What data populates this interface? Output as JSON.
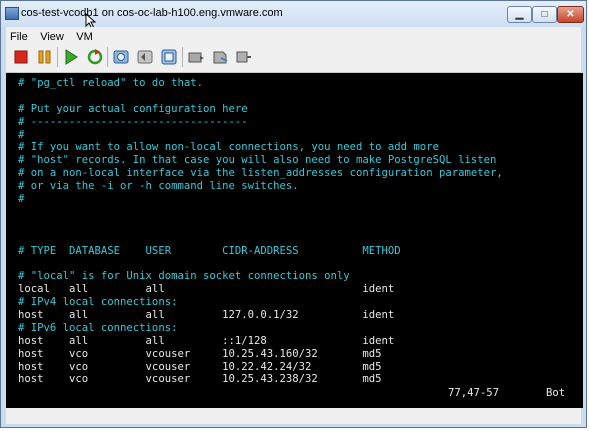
{
  "window": {
    "title": "cos-test-vcodb1 on cos-oc-lab-h100.eng.vmware.com"
  },
  "menu": [
    "File",
    "View",
    "VM"
  ],
  "toolbar": {
    "buttons": [
      "power-off",
      "suspend",
      "power-on",
      "reset",
      "snapshot",
      "revert-snapshot",
      "manage-snapshots",
      "connect-cd",
      "connect-floppy",
      "connect-network"
    ]
  },
  "console": {
    "lines": [
      {
        "cls": "cmt",
        "text": "# \"pg_ctl reload\" to do that."
      },
      {
        "cls": "cmt",
        "text": ""
      },
      {
        "cls": "cmt",
        "text": "# Put your actual configuration here"
      },
      {
        "cls": "cmt",
        "text": "# ----------------------------------"
      },
      {
        "cls": "cmt",
        "text": "#"
      },
      {
        "cls": "cmt",
        "text": "# If you want to allow non-local connections, you need to add more"
      },
      {
        "cls": "cmt",
        "text": "# \"host\" records. In that case you will also need to make PostgreSQL listen"
      },
      {
        "cls": "cmt",
        "text": "# on a non-local interface via the listen_addresses configuration parameter,"
      },
      {
        "cls": "cmt",
        "text": "# or via the -i or -h command line switches."
      },
      {
        "cls": "cmt",
        "text": "#"
      },
      {
        "cls": "cmt",
        "text": ""
      },
      {
        "cls": "cmt",
        "text": ""
      },
      {
        "cls": "cmt",
        "text": ""
      },
      {
        "cls": "cmt",
        "text": "# TYPE  DATABASE    USER        CIDR-ADDRESS          METHOD"
      },
      {
        "cls": "cmt",
        "text": ""
      },
      {
        "cls": "cmt",
        "text": "# \"local\" is for Unix domain socket connections only"
      },
      {
        "cls": "txt",
        "text": "local   all         all                               ident"
      },
      {
        "cls": "cmt",
        "text": "# IPv4 local connections:"
      },
      {
        "cls": "txt",
        "text": "host    all         all         127.0.0.1/32          ident"
      },
      {
        "cls": "cmt",
        "text": "# IPv6 local connections:"
      },
      {
        "cls": "txt",
        "text": "host    all         all         ::1/128               ident"
      },
      {
        "cls": "txt",
        "text": "host    vco         vcouser     10.25.43.160/32       md5"
      },
      {
        "cls": "txt",
        "text": "host    vco         vcouser     10.22.42.24/32        md5"
      },
      {
        "cls": "txt",
        "text": "host    vco         vcouser     10.25.43.238/32       md5"
      }
    ],
    "cursor_position": "77,47-57",
    "scroll_position": "Bot"
  }
}
